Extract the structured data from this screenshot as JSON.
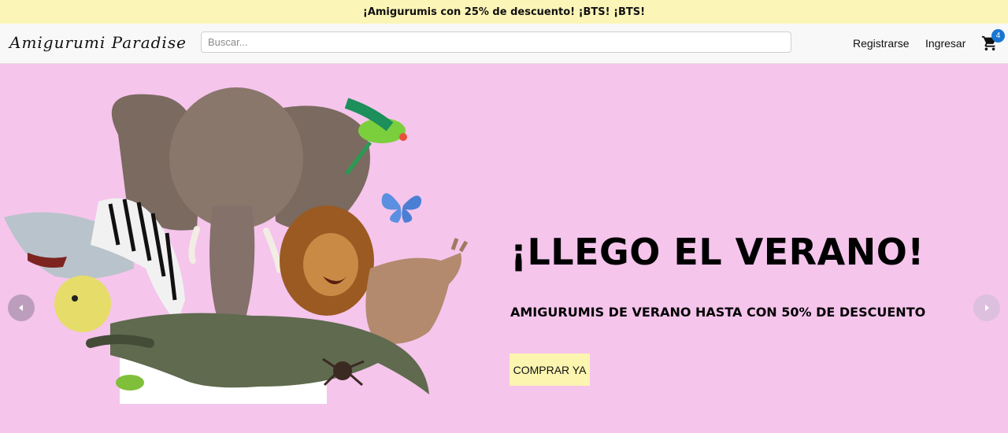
{
  "announcement": "¡Amigurumis con 25% de descuento! ¡BTS! ¡BTS!",
  "header": {
    "brand": "Amigurumi Paradise",
    "search_placeholder": "Buscar...",
    "register_label": "Registrarse",
    "login_label": "Ingresar",
    "cart_icon": "shopping-cart-icon",
    "cart_count": "4"
  },
  "hero": {
    "title": "¡LLEGO EL VERANO!",
    "subtitle": "AMIGURUMIS DE VERANO HASTA CON 50% DE DESCUENTO",
    "cta_label": "COMPRAR YA",
    "prev_icon": "chevron-left-icon",
    "next_icon": "chevron-right-icon"
  },
  "colors": {
    "announcement_bg": "#fbf5b8",
    "hero_bg": "#f5c5ec",
    "cta_bg": "#fbf5b0",
    "badge": "#1976d2"
  }
}
